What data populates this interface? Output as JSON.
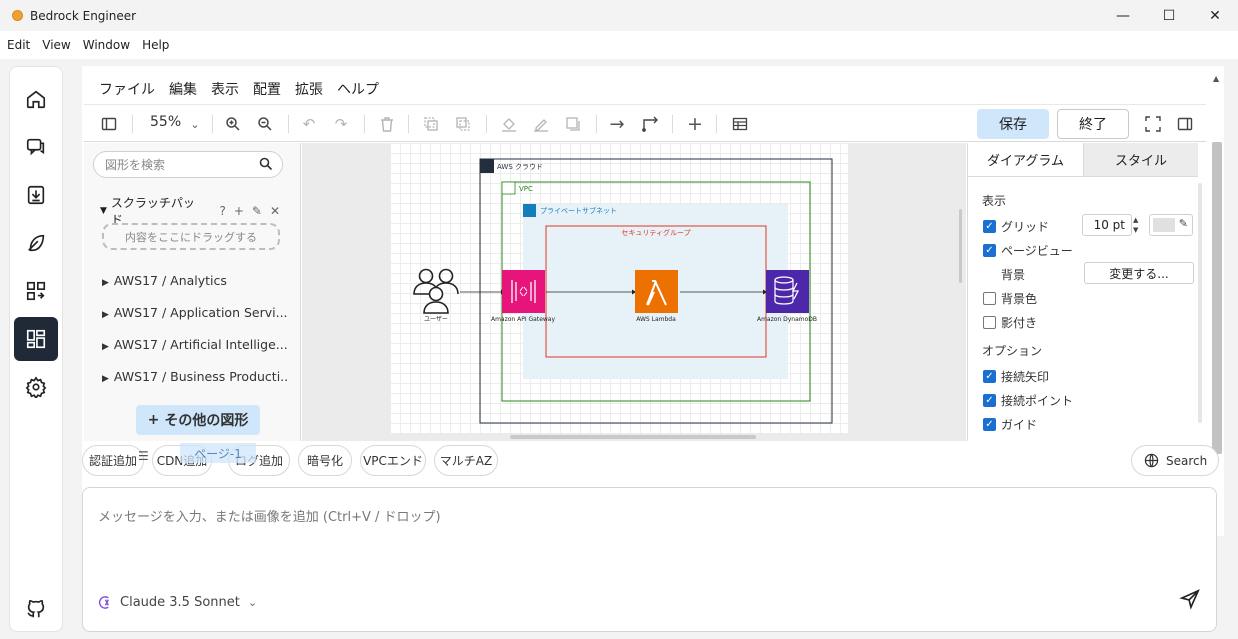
{
  "window": {
    "title": "Bedrock Engineer",
    "controls": [
      "—",
      "☐",
      "✕"
    ]
  },
  "menubar": [
    "Edit",
    "View",
    "Window",
    "Help"
  ],
  "drawio": {
    "menu": [
      "ファイル",
      "編集",
      "表示",
      "配置",
      "拡張",
      "ヘルプ"
    ],
    "zoom": "55%",
    "save_label": "保存",
    "exit_label": "終了",
    "shape_search_placeholder": "図形を検索",
    "scratchpad": {
      "label": "スクラッチパッド",
      "dropzone": "内容をここにドラッグする"
    },
    "libraries": [
      "AWS17 / Analytics",
      "AWS17 / Application Servi...",
      "AWS17 / Artificial Intellige...",
      "AWS17 / Business Producti..."
    ],
    "more_shapes": "その他の図形",
    "page_tab": "ページ-1",
    "diagram": {
      "cloud": "AWS クラウド",
      "vpc": "VPC",
      "subnet": "プライベートサブネット",
      "sg": "セキュリティグループ",
      "user": "ユーザー",
      "apigw": "Amazon API Gateway",
      "lambda": "AWS Lambda",
      "dynamo": "Amazon DynamoDB"
    },
    "format": {
      "tab_diagram": "ダイアグラム",
      "tab_style": "スタイル",
      "section_view": "表示",
      "grid": "グリッド",
      "grid_size": "10 pt",
      "page_view": "ページビュー",
      "background": "背景",
      "change": "変更する...",
      "bg_color": "背景色",
      "shadow": "影付き",
      "section_options": "オプション",
      "connection_arrows": "接続矢印",
      "connection_points": "接続ポイント",
      "guides": "ガイド"
    }
  },
  "quick_actions": [
    "認証追加",
    "CDN追加",
    "ログ追加",
    "暗号化",
    "VPCエンド",
    "マルチAZ"
  ],
  "search_label": "Search",
  "chat": {
    "placeholder": "メッセージを入力、または画像を追加 (Ctrl+V / ドロップ)",
    "model": "Claude 3.5 Sonnet"
  },
  "colors": {
    "accent_blue": "#cfe6fb",
    "sidebar_active": "#1f2937",
    "apigw": "#e7157b",
    "lambda": "#ed7100",
    "dynamo": "#4d27aa"
  }
}
